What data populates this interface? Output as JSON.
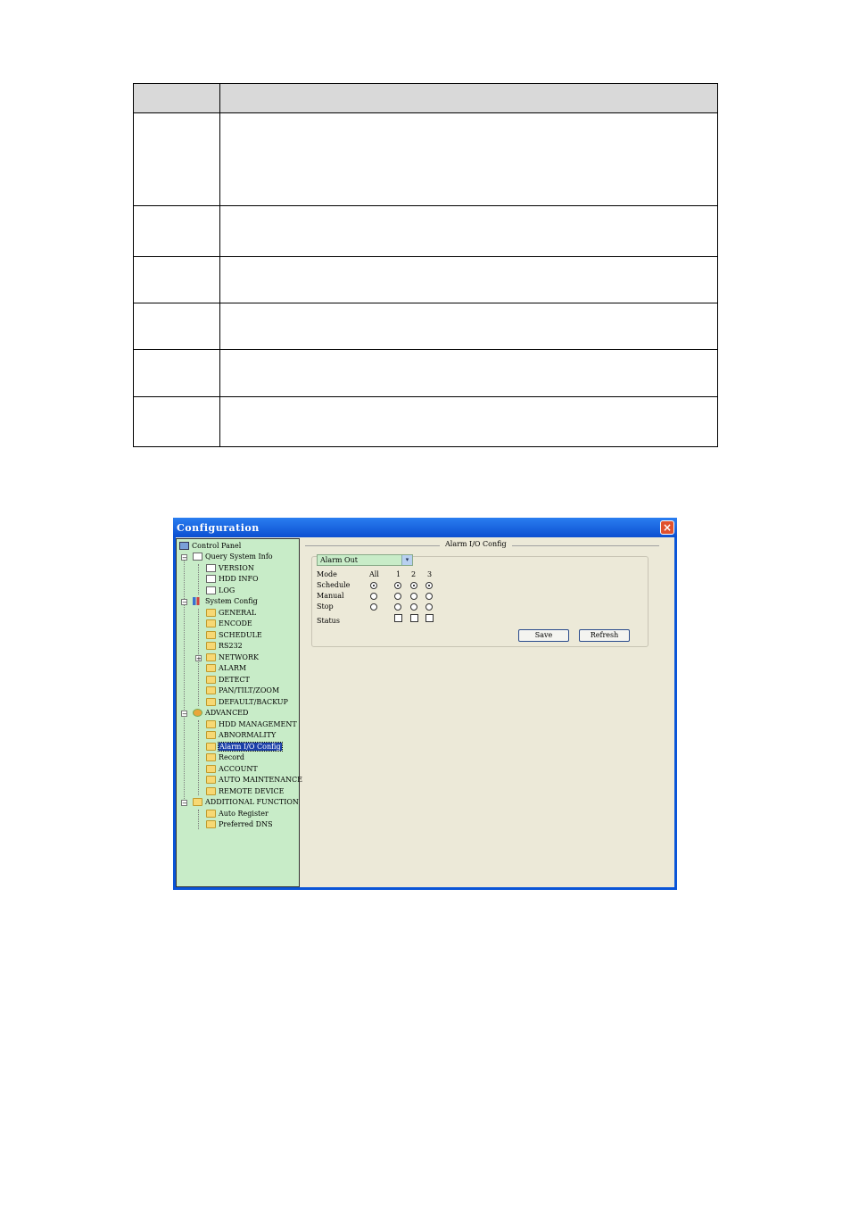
{
  "window": {
    "title": "Configuration",
    "close_glyph": "×"
  },
  "tree": {
    "root": "Control Panel",
    "items": [
      {
        "label": "Query System Info"
      },
      {
        "label": "VERSION"
      },
      {
        "label": "HDD INFO"
      },
      {
        "label": "LOG"
      },
      {
        "label": "System Config"
      },
      {
        "label": "GENERAL"
      },
      {
        "label": "ENCODE"
      },
      {
        "label": "SCHEDULE"
      },
      {
        "label": "RS232"
      },
      {
        "label": "NETWORK"
      },
      {
        "label": "ALARM"
      },
      {
        "label": "DETECT"
      },
      {
        "label": "PAN/TILT/ZOOM"
      },
      {
        "label": "DEFAULT/BACKUP"
      },
      {
        "label": "ADVANCED"
      },
      {
        "label": "HDD MANAGEMENT"
      },
      {
        "label": "ABNORMALITY"
      },
      {
        "label": "Alarm I/O Config"
      },
      {
        "label": "Record"
      },
      {
        "label": "ACCOUNT"
      },
      {
        "label": "AUTO MAINTENANCE"
      },
      {
        "label": "REMOTE DEVICE"
      },
      {
        "label": "ADDITIONAL FUNCTION"
      },
      {
        "label": "Auto Register"
      },
      {
        "label": "Preferred DNS"
      }
    ],
    "expander_minus": "−",
    "expander_plus": "+"
  },
  "panel": {
    "group_title": "Alarm I/O Config",
    "select_value": "Alarm Out",
    "select_arrow": "▾",
    "mode_label": "Mode",
    "col_all": "All",
    "col_1": "1",
    "col_2": "2",
    "col_3": "3",
    "row_schedule": "Schedule",
    "row_manual": "Manual",
    "row_stop": "Stop",
    "row_status": "Status",
    "save": "Save",
    "refresh": "Refresh"
  }
}
